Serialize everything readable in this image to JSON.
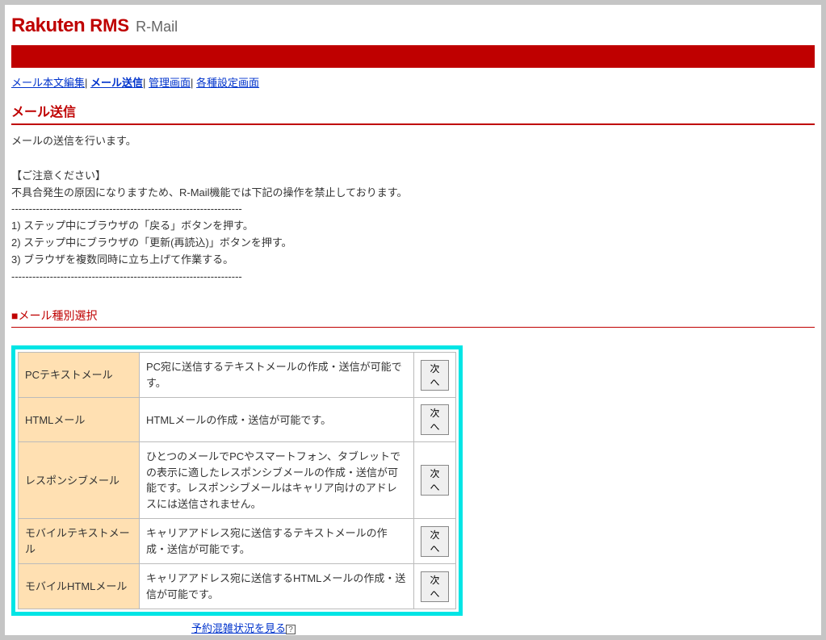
{
  "logo": {
    "brand": "Rakuten",
    "suffix": "RMS",
    "subtitle": "R-Mail"
  },
  "breadcrumbs": {
    "items": [
      {
        "label": "メール本文編集",
        "active": false
      },
      {
        "label": "メール送信",
        "active": true
      },
      {
        "label": "管理画面",
        "active": false
      },
      {
        "label": "各種設定画面",
        "active": false
      }
    ],
    "separator": "| "
  },
  "page_title": "メール送信",
  "intro": "メールの送信を行います。",
  "caution": {
    "header": "【ご注意ください】",
    "lead": "不具合発生の原因になりますため、R-Mail機能では下記の操作を禁止しております。",
    "divider": "------------------------------------------------------------------",
    "items": [
      "1) ステップ中にブラウザの「戻る」ボタンを押す。",
      "2) ステップ中にブラウザの「更新(再読込)」ボタンを押す。",
      "3) ブラウザを複数同時に立ち上げて作業する。"
    ]
  },
  "section_title": "■メール種別選択",
  "next_label": "次へ",
  "mail_types": [
    {
      "name": "PCテキストメール",
      "desc": "PC宛に送信するテキストメールの作成・送信が可能です。"
    },
    {
      "name": "HTMLメール",
      "desc": "HTMLメールの作成・送信が可能です。"
    },
    {
      "name": "レスポンシブメール",
      "desc": "ひとつのメールでPCやスマートフォン、タブレットでの表示に適したレスポンシブメールの作成・送信が可能です。レスポンシブメールはキャリア向けのアドレスには送信されません。"
    },
    {
      "name": "モバイルテキストメール",
      "desc": "キャリアアドレス宛に送信するテキストメールの作成・送信が可能です。"
    },
    {
      "name": "モバイルHTMLメール",
      "desc": "キャリアアドレス宛に送信するHTMLメールの作成・送信が可能です。"
    }
  ],
  "footer_link": "予約混雑状況を見る"
}
